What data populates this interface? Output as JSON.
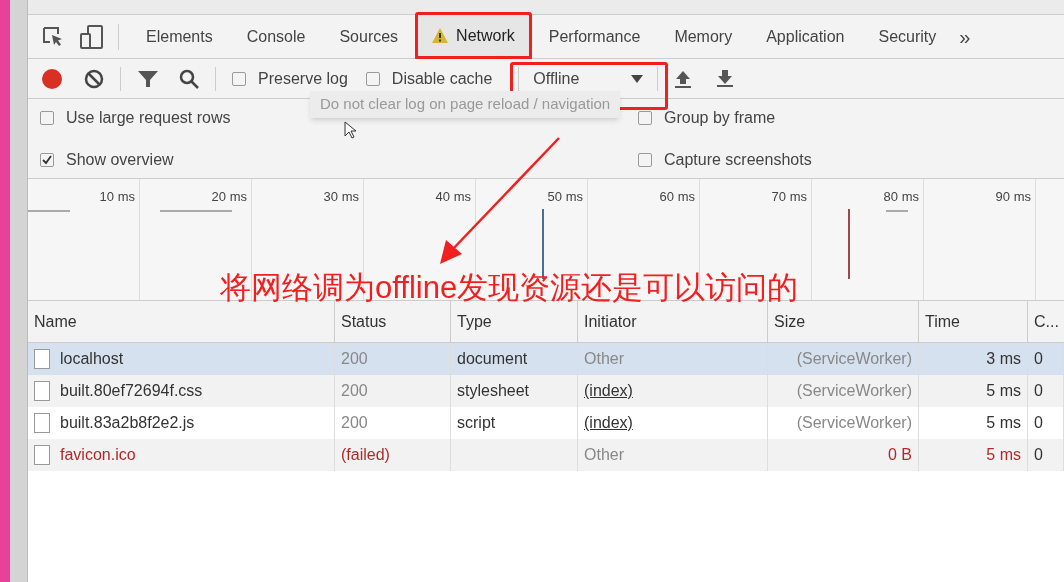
{
  "tabs": [
    {
      "label": "Elements",
      "selected": false,
      "warning": false
    },
    {
      "label": "Console",
      "selected": false,
      "warning": false
    },
    {
      "label": "Sources",
      "selected": false,
      "warning": false
    },
    {
      "label": "Network",
      "selected": true,
      "warning": true
    },
    {
      "label": "Performance",
      "selected": false,
      "warning": false
    },
    {
      "label": "Memory",
      "selected": false,
      "warning": false
    },
    {
      "label": "Application",
      "selected": false,
      "warning": false
    },
    {
      "label": "Security",
      "selected": false,
      "warning": false
    }
  ],
  "more_tabs": "»",
  "toolbar": {
    "recording": true,
    "options": [
      {
        "label": "Preserve log",
        "checked": false
      },
      {
        "label": "Disable cache",
        "checked": false
      }
    ],
    "throttling": "Offline"
  },
  "tooltip": "Do not clear log on page reload / navigation",
  "settings_left": [
    {
      "label": "Use large request rows",
      "checked": false
    },
    {
      "label": "Show overview",
      "checked": true
    }
  ],
  "settings_right": [
    {
      "label": "Group by frame",
      "checked": false
    },
    {
      "label": "Capture screenshots",
      "checked": false
    }
  ],
  "overview": {
    "ticks": [
      "10 ms",
      "20 ms",
      "30 ms",
      "40 ms",
      "50 ms",
      "60 ms",
      "70 ms",
      "80 ms",
      "90 ms"
    ]
  },
  "table": {
    "columns": [
      "Name",
      "Status",
      "Type",
      "Initiator",
      "Size",
      "Time",
      "C..."
    ],
    "rows": [
      {
        "name": "localhost",
        "status": "200",
        "type": "document",
        "initiator": "Other",
        "initiator_link": false,
        "size": "(ServiceWorker)",
        "time": "3 ms",
        "column_7": "0",
        "selected": true,
        "failed": false
      },
      {
        "name": "built.80ef72694f.css",
        "status": "200",
        "type": "stylesheet",
        "initiator": "(index)",
        "initiator_link": true,
        "size": "(ServiceWorker)",
        "time": "5 ms",
        "column_7": "0",
        "selected": false,
        "failed": false
      },
      {
        "name": "built.83a2b8f2e2.js",
        "status": "200",
        "type": "script",
        "initiator": "(index)",
        "initiator_link": true,
        "size": "(ServiceWorker)",
        "time": "5 ms",
        "column_7": "0",
        "selected": false,
        "failed": false
      },
      {
        "name": "favicon.ico",
        "status": "(failed)",
        "type": "",
        "initiator": "Other",
        "initiator_link": false,
        "size": "0 B",
        "time": "5 ms",
        "column_7": "0",
        "selected": false,
        "failed": true
      }
    ]
  },
  "annotation": "将网络调为offline发现资源还是可以访问的"
}
